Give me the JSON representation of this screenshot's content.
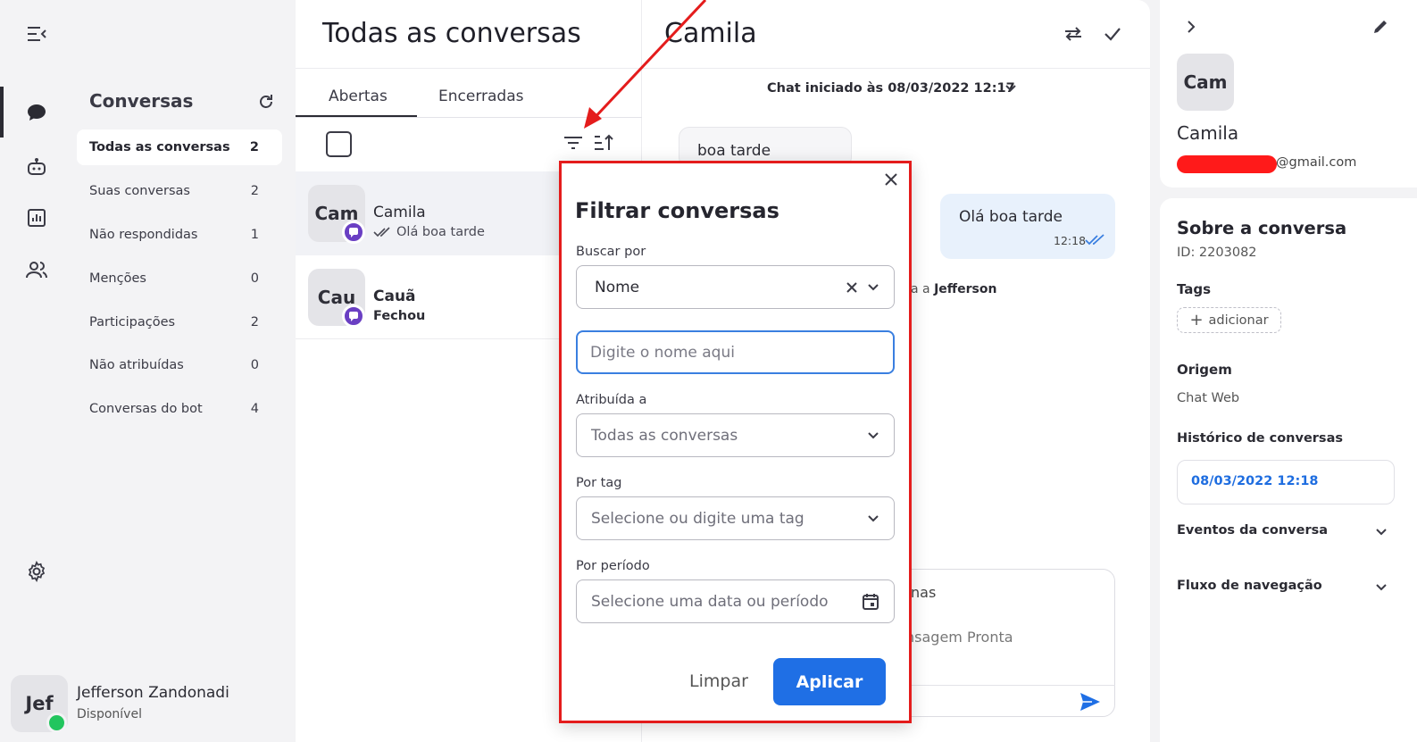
{
  "sidebar": {
    "title": "Conversas",
    "items": [
      {
        "label": "Todas as conversas",
        "count": "2"
      },
      {
        "label": "Suas conversas",
        "count": "2"
      },
      {
        "label": "Não respondidas",
        "count": "1"
      },
      {
        "label": "Menções",
        "count": "0"
      },
      {
        "label": "Participações",
        "count": "2"
      },
      {
        "label": "Não atribuídas",
        "count": "0"
      },
      {
        "label": "Conversas do bot",
        "count": "4"
      }
    ]
  },
  "rail_icons": [
    "menu-collapse-icon",
    "chat-icon",
    "bot-icon",
    "reports-icon",
    "team-icon",
    "settings-icon"
  ],
  "user": {
    "initials": "Jef",
    "name": "Jefferson Zandonadi",
    "status": "Disponível"
  },
  "list": {
    "title": "Todas as conversas",
    "tabs": [
      "Abertas",
      "Encerradas"
    ],
    "conversations": [
      {
        "initials": "Cam",
        "name": "Camila",
        "last_message": "Olá boa tarde"
      },
      {
        "initials": "Cau",
        "name": "Cauã",
        "last_message": "Fechou"
      }
    ]
  },
  "chat": {
    "title": "Camila",
    "started": "Chat iniciado às 08/03/2022 12:17",
    "incoming": "boa tarde",
    "outgoing": "Olá boa tarde",
    "outgoing_time": "12:18",
    "assigned_prefix": "a a ",
    "assigned_name": "Jefferson",
    "composer_line1": "nas",
    "composer_line2": "nsagem Pronta"
  },
  "contact": {
    "initials": "Cam",
    "name": "Camila",
    "email_suffix": "@gmail.com"
  },
  "about": {
    "title": "Sobre a conversa",
    "id": "ID: 2203082",
    "tags_label": "Tags",
    "tag_add": "adicionar",
    "origin_label": "Origem",
    "origin_value": "Chat Web",
    "history_label": "Histórico de conversas",
    "history_entry": "08/03/2022 12:18",
    "events_label": "Eventos da conversa",
    "flow_label": "Fluxo de navegação"
  },
  "filter_modal": {
    "title": "Filtrar conversas",
    "search_by_label": "Buscar por",
    "search_by_value": "Nome",
    "name_placeholder": "Digite o nome aqui",
    "assigned_label": "Atribuída a",
    "assigned_value": "Todas as conversas",
    "tag_label": "Por tag",
    "tag_placeholder": "Selecione ou digite uma tag",
    "period_label": "Por período",
    "period_placeholder": "Selecione uma data ou período",
    "clear_label": "Limpar",
    "apply_label": "Aplicar"
  },
  "colors": {
    "accent": "#1f6fe5",
    "annotation_red": "#e41c1c",
    "badge_purple": "#6a3fc3",
    "online_green": "#22c55e"
  }
}
